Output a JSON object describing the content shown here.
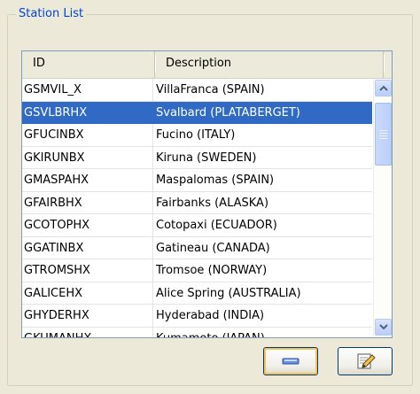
{
  "group": {
    "title": "Station List"
  },
  "table": {
    "columns": [
      "ID",
      "Description"
    ],
    "selected_index": 1,
    "rows": [
      {
        "id": "GSMVIL_X",
        "description": "VillaFranca (SPAIN)"
      },
      {
        "id": "GSVLBRHX",
        "description": "Svalbard (PLATABERGET)"
      },
      {
        "id": "GFUCINBX",
        "description": "Fucino (ITALY)"
      },
      {
        "id": "GKIRUNBX",
        "description": "Kiruna (SWEDEN)"
      },
      {
        "id": "GMASPAHX",
        "description": "Maspalomas (SPAIN)"
      },
      {
        "id": "GFAIRBHX",
        "description": "Fairbanks (ALASKA)"
      },
      {
        "id": "GCOTOPHX",
        "description": "Cotopaxi (ECUADOR)"
      },
      {
        "id": "GGATINBX",
        "description": "Gatineau (CANADA)"
      },
      {
        "id": "GTROMSHX",
        "description": "Tromsoe (NORWAY)"
      },
      {
        "id": "GALICEHX",
        "description": "Alice Spring (AUSTRALIA)"
      },
      {
        "id": "GHYDERHX",
        "description": "Hyderabad (INDIA)"
      },
      {
        "id": "GKUMANHX",
        "description": "Kumamoto (JAPAN)"
      }
    ]
  },
  "buttons": [
    {
      "icon": "minus-icon"
    },
    {
      "icon": "edit-icon"
    }
  ],
  "colors": {
    "selection": "#316ac5",
    "title": "#0046d5"
  }
}
